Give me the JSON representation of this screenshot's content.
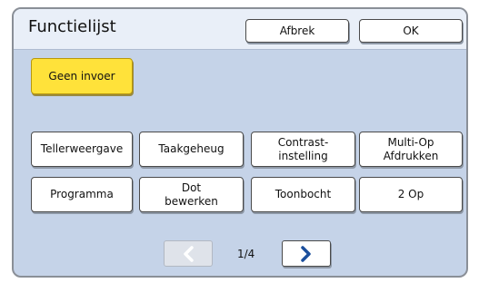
{
  "dialog": {
    "title": "Functielijst",
    "cancel_label": "Afbrek",
    "ok_label": "OK"
  },
  "no_input_button": {
    "label": "Geen invoer",
    "color": "#ffe23a"
  },
  "functions": [
    {
      "label": "Tellerweergave"
    },
    {
      "label": "Taakgeheug"
    },
    {
      "label": "Contrast-\ninstelling"
    },
    {
      "label": "Multi-Op\nAfdrukken"
    },
    {
      "label": "Programma"
    },
    {
      "label": "Dot\nbewerken"
    },
    {
      "label": "Toonbocht"
    },
    {
      "label": "2 Op"
    }
  ],
  "pagination": {
    "indicator": "1/4",
    "prev_icon": "chevron-left-icon",
    "prev_enabled": false,
    "next_icon": "chevron-right-icon",
    "next_enabled": true
  }
}
